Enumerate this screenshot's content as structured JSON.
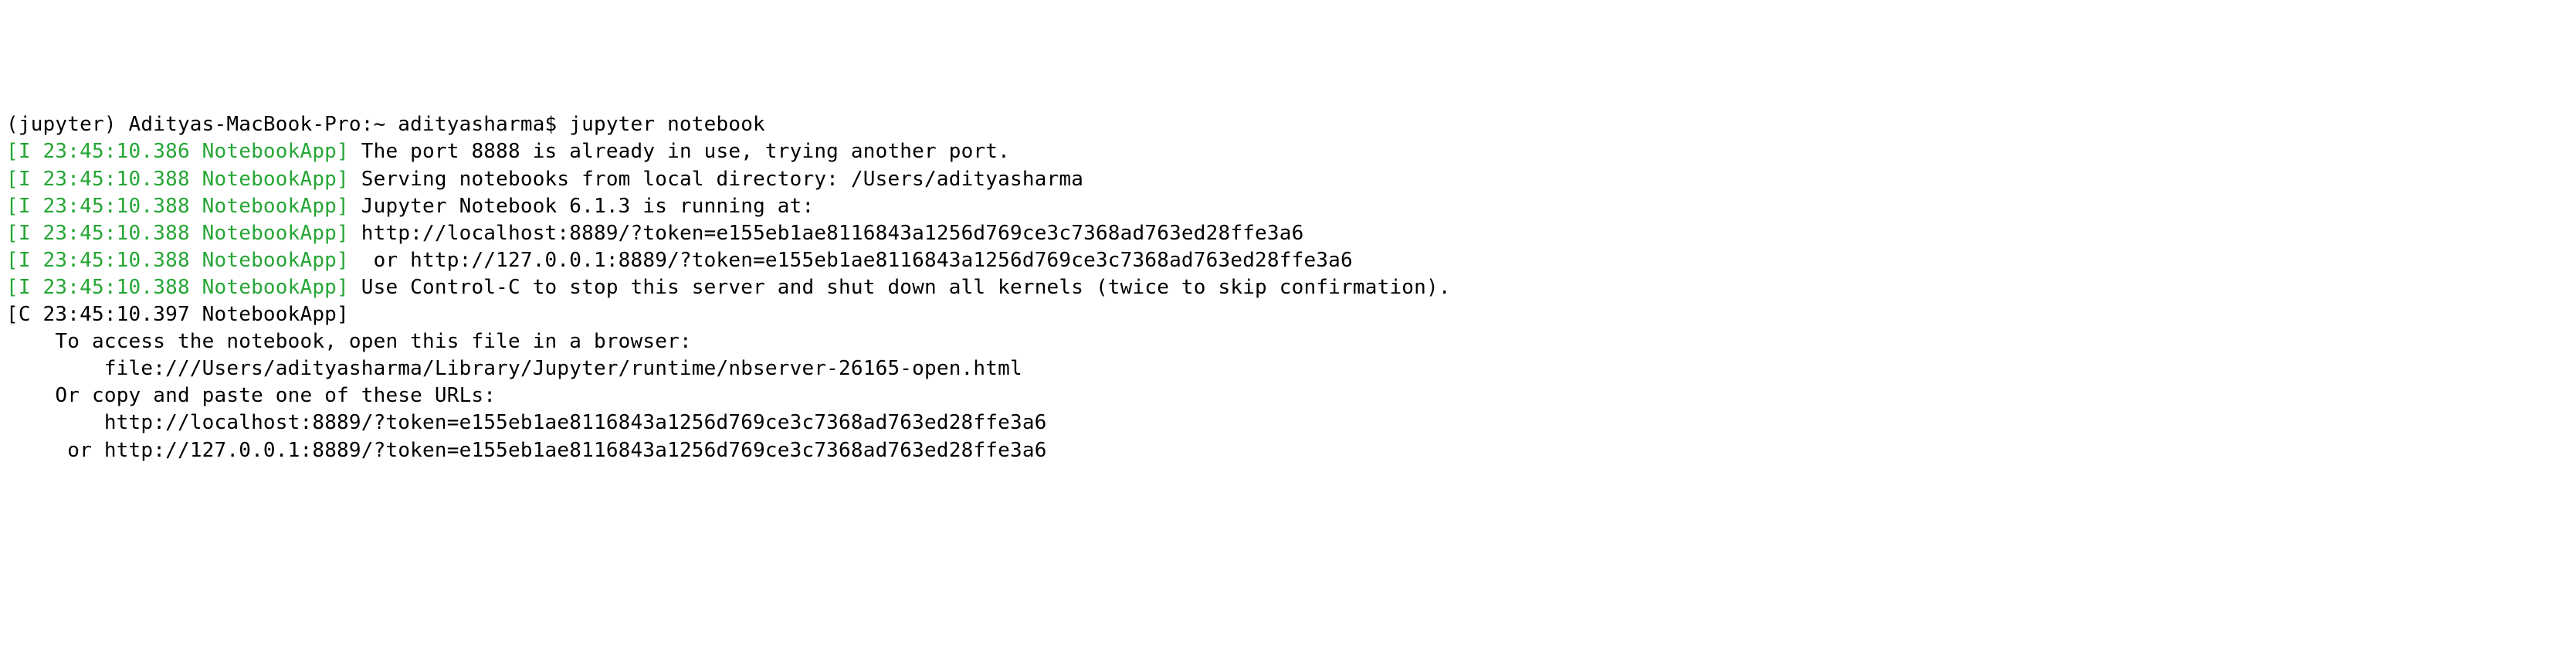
{
  "terminal": {
    "prompt_line": "(jupyter) Adityas-MacBook-Pro:~ adityasharma$ jupyter notebook",
    "log_prefix_1": "[I 23:45:10.386 NotebookApp]",
    "log_msg_1": " The port 8888 is already in use, trying another port.",
    "log_prefix_2": "[I 23:45:10.388 NotebookApp]",
    "log_msg_2": " Serving notebooks from local directory: /Users/adityasharma",
    "log_prefix_3": "[I 23:45:10.388 NotebookApp]",
    "log_msg_3": " Jupyter Notebook 6.1.3 is running at:",
    "log_prefix_4": "[I 23:45:10.388 NotebookApp]",
    "log_msg_4": " http://localhost:8889/?token=e155eb1ae8116843a1256d769ce3c7368ad763ed28ffe3a6",
    "log_prefix_5": "[I 23:45:10.388 NotebookApp]",
    "log_msg_5": "  or http://127.0.0.1:8889/?token=e155eb1ae8116843a1256d769ce3c7368ad763ed28ffe3a6",
    "log_prefix_6": "[I 23:45:10.388 NotebookApp]",
    "log_msg_6": " Use Control-C to stop this server and shut down all kernels (twice to skip confirmation).",
    "log_prefix_7": "[C 23:45:10.397 NotebookApp]",
    "blank": "",
    "instr_1": "    To access the notebook, open this file in a browser:",
    "instr_2": "        file:///Users/adityasharma/Library/Jupyter/runtime/nbserver-26165-open.html",
    "instr_3": "    Or copy and paste one of these URLs:",
    "instr_4": "        http://localhost:8889/?token=e155eb1ae8116843a1256d769ce3c7368ad763ed28ffe3a6",
    "instr_5": "     or http://127.0.0.1:8889/?token=e155eb1ae8116843a1256d769ce3c7368ad763ed28ffe3a6"
  }
}
